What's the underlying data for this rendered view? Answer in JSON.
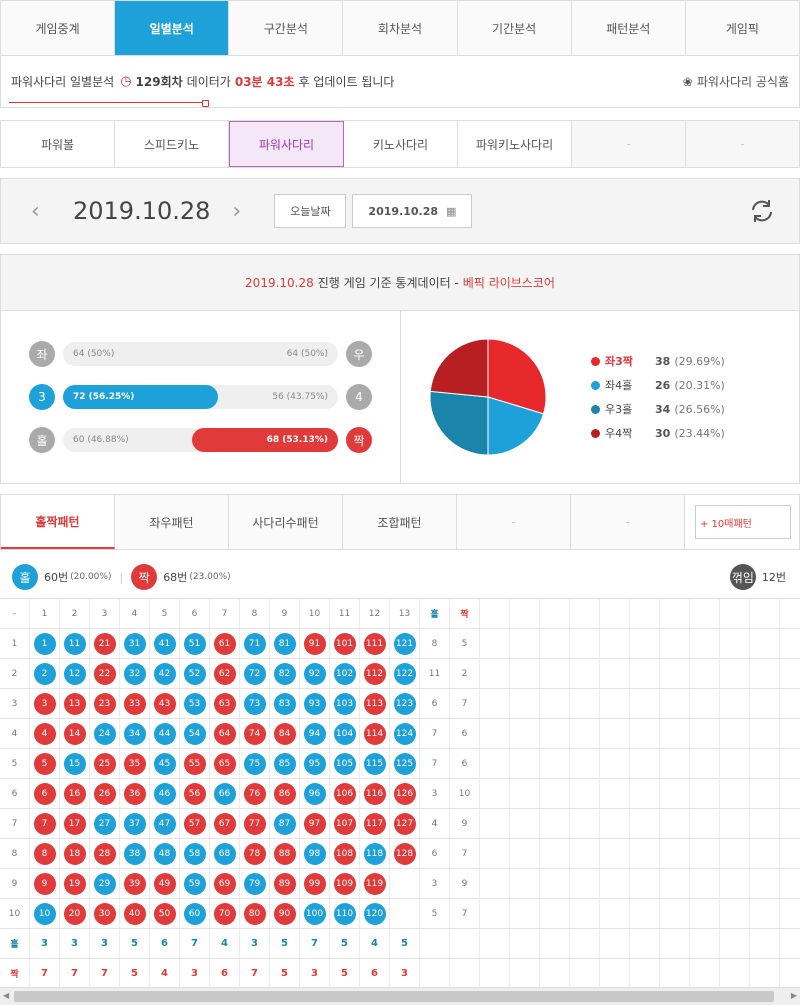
{
  "top_tabs": [
    "게임중계",
    "일별분석",
    "구간분석",
    "회차분석",
    "기간분석",
    "패턴분석",
    "게임픽"
  ],
  "info": {
    "prefix": "파워사다리 일별분석",
    "round": "129회차",
    "mid": "데이터가",
    "time": "03분 43초",
    "suffix": "후 업데이트 됩니다",
    "official": "파워사다리 공식홈"
  },
  "sub_tabs": [
    "파워볼",
    "스피드키노",
    "파워사다리",
    "키노사다리",
    "파워키노사다리",
    "-",
    "-"
  ],
  "date_bar": {
    "date": "2019.10.28",
    "today_btn": "오늘날짜",
    "date_input": "2019.10.28"
  },
  "stats": {
    "date": "2019.10.28",
    "title": "진행 게임 기준 통계데이터 -",
    "brand": "베픽 라이브스코어",
    "rows": [
      {
        "l": "좌",
        "r": "우",
        "lv": "64 (50%)",
        "rv": "64 (50%)",
        "lfill": 0,
        "rfill": 0
      },
      {
        "l": "3",
        "r": "4",
        "lv": "72 (56.25%)",
        "rv": "56 (43.75%)",
        "lfill": 0.5625,
        "rfill": 0
      },
      {
        "l": "홀",
        "r": "짝",
        "lv": "60 (46.88%)",
        "rv": "68 (53.13%)",
        "lfill": 0,
        "rfill": 0.5313
      }
    ],
    "legend": [
      {
        "name": "좌3짝",
        "v": "38",
        "p": "(29.69%)",
        "color": "#e8292c",
        "value": 38
      },
      {
        "name": "좌4홀",
        "v": "26",
        "p": "(20.31%)",
        "color": "#1ea1d8",
        "value": 26
      },
      {
        "name": "우3홀",
        "v": "34",
        "p": "(26.56%)",
        "color": "#1a84ab",
        "value": 34
      },
      {
        "name": "우4짝",
        "v": "30",
        "p": "(23.44%)",
        "color": "#b81f22",
        "value": 30
      }
    ]
  },
  "pattern_tabs": [
    "홀짝패턴",
    "좌우패턴",
    "사다리수패턴",
    "조합패턴",
    "-",
    "-"
  ],
  "pattern_plus": "+ 10매패턴",
  "summary": {
    "odd": "홀",
    "odd_v": "60번",
    "odd_p": "(20.00%)",
    "even": "짝",
    "even_v": "68번",
    "even_p": "(23.00%)",
    "turn": "꺾임",
    "turn_v": "12번"
  },
  "grid": {
    "cols": [
      "1",
      "2",
      "3",
      "4",
      "5",
      "6",
      "7",
      "8",
      "9",
      "10",
      "11",
      "12",
      "13"
    ],
    "odd_head": "홀",
    "even_head": "짝",
    "dash": "-",
    "row_labels": [
      "1",
      "2",
      "3",
      "4",
      "5",
      "6",
      "7",
      "8",
      "9",
      "10"
    ],
    "odd_counts": [
      "8",
      "11",
      "6",
      "7",
      "7",
      "3",
      "4",
      "6",
      "3",
      "5"
    ],
    "even_counts": [
      "5",
      "2",
      "7",
      "6",
      "6",
      "10",
      "9",
      "7",
      "9",
      "7"
    ],
    "col_odd": [
      "3",
      "3",
      "3",
      "5",
      "6",
      "7",
      "4",
      "3",
      "5",
      "7",
      "5",
      "4",
      "5"
    ],
    "col_even": [
      "7",
      "7",
      "7",
      "5",
      "4",
      "3",
      "6",
      "7",
      "5",
      "3",
      "5",
      "6",
      "3"
    ],
    "balls": [
      [
        "b",
        "b",
        "r",
        "b",
        "b",
        "b",
        "r",
        "b",
        "b",
        "r",
        "r",
        "r",
        "b"
      ],
      [
        "b",
        "b",
        "r",
        "b",
        "b",
        "b",
        "r",
        "b",
        "b",
        "b",
        "b",
        "r",
        "b"
      ],
      [
        "r",
        "r",
        "r",
        "r",
        "r",
        "b",
        "r",
        "b",
        "b",
        "b",
        "b",
        "r",
        "b"
      ],
      [
        "r",
        "r",
        "b",
        "b",
        "b",
        "b",
        "r",
        "r",
        "r",
        "b",
        "b",
        "r",
        "b"
      ],
      [
        "r",
        "b",
        "r",
        "r",
        "b",
        "r",
        "r",
        "b",
        "b",
        "b",
        "b",
        "b",
        "b"
      ],
      [
        "r",
        "r",
        "r",
        "r",
        "b",
        "r",
        "b",
        "r",
        "r",
        "b",
        "r",
        "r",
        "r"
      ],
      [
        "r",
        "r",
        "b",
        "b",
        "b",
        "r",
        "r",
        "r",
        "b",
        "r",
        "r",
        "r",
        "r"
      ],
      [
        "r",
        "r",
        "r",
        "b",
        "b",
        "b",
        "b",
        "r",
        "r",
        "b",
        "r",
        "b",
        "r"
      ],
      [
        "r",
        "r",
        "b",
        "r",
        "r",
        "b",
        "r",
        "b",
        "r",
        "r",
        "r",
        "r",
        ""
      ],
      [
        "b",
        "r",
        "r",
        "r",
        "r",
        "b",
        "r",
        "r",
        "r",
        "b",
        "b",
        "b",
        ""
      ]
    ]
  }
}
